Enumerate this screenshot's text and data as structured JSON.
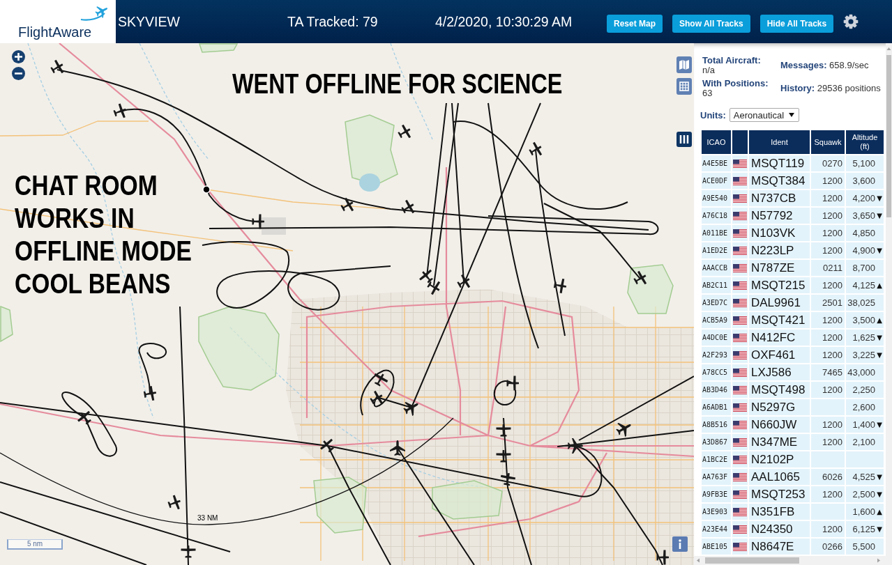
{
  "header": {
    "logo_text": "FlightAware",
    "title": "SKYVIEW",
    "tracked": "TA Tracked: 79",
    "datetime": "4/2/2020, 10:30:29 AM",
    "buttons": [
      "Reset Map",
      "Show All Tracks",
      "Hide All Tracks"
    ]
  },
  "map": {
    "annotations": [
      {
        "kind": "banner",
        "text": "WENT OFFLINE FOR SCIENCE"
      },
      {
        "kind": "note",
        "text": "CHAT ROOM WORKS IN OFFLINE MODE COOL BEANS"
      }
    ],
    "range_label": "33 NM",
    "scale_label": "5 nm"
  },
  "panel": {
    "stats": [
      {
        "label": "Total Aircraft:",
        "value": "n/a"
      },
      {
        "label": "Messages:",
        "value": "658.9/sec"
      },
      {
        "label": "With Positions:",
        "value": "63"
      },
      {
        "label": "History:",
        "value": "29536 positions"
      }
    ],
    "units": {
      "label": "Units:",
      "value": "Aeronautical"
    },
    "table": {
      "columns": [
        "ICAO",
        "Ident",
        "Squawk",
        "Altitude (ft)"
      ],
      "rows": [
        {
          "icao": "A4E5BE",
          "ident": "MSQT119",
          "squawk": "0270",
          "altitude": "5,100"
        },
        {
          "icao": "ACE0DF",
          "ident": "MSQT384",
          "squawk": "1200",
          "altitude": "3,600"
        },
        {
          "icao": "A9E540",
          "ident": "N737CB",
          "squawk": "1200",
          "altitude": "4,200",
          "trend": "▼"
        },
        {
          "icao": "A76C18",
          "ident": "N57792",
          "squawk": "1200",
          "altitude": "3,650",
          "trend": "▼"
        },
        {
          "icao": "A011BE",
          "ident": "N103VK",
          "squawk": "1200",
          "altitude": "4,850"
        },
        {
          "icao": "A1ED2E",
          "ident": "N223LP",
          "squawk": "1200",
          "altitude": "4,900",
          "trend": "▼"
        },
        {
          "icao": "AAACCB",
          "ident": "N787ZE",
          "squawk": "0211",
          "altitude": "8,700"
        },
        {
          "icao": "AB2C11",
          "ident": "MSQT215",
          "squawk": "1200",
          "altitude": "4,125",
          "trend": "▲"
        },
        {
          "icao": "A3ED7C",
          "ident": "DAL9961",
          "squawk": "2501",
          "altitude": "38,025"
        },
        {
          "icao": "ACB5A9",
          "ident": "MSQT421",
          "squawk": "1200",
          "altitude": "3,500",
          "trend": "▲"
        },
        {
          "icao": "A4DC0E",
          "ident": "N412FC",
          "squawk": "1200",
          "altitude": "1,625",
          "trend": "▼"
        },
        {
          "icao": "A2F293",
          "ident": "OXF461",
          "squawk": "1200",
          "altitude": "3,225",
          "trend": "▼"
        },
        {
          "icao": "A78CC5",
          "ident": "LXJ586",
          "squawk": "7465",
          "altitude": "43,000"
        },
        {
          "icao": "AB3D46",
          "ident": "MSQT498",
          "squawk": "1200",
          "altitude": "2,250"
        },
        {
          "icao": "A6ADB1",
          "ident": "N5297G",
          "altitude": "2,600"
        },
        {
          "icao": "A8B516",
          "ident": "N660JW",
          "squawk": "1200",
          "altitude": "1,400",
          "trend": "▼"
        },
        {
          "icao": "A3D867",
          "ident": "N347ME",
          "squawk": "1200",
          "altitude": "2,100"
        },
        {
          "icao": "A1BC2E",
          "ident": "N2102P"
        },
        {
          "icao": "AA763F",
          "ident": "AAL1065",
          "squawk": "6026",
          "altitude": "4,525",
          "trend": "▼"
        },
        {
          "icao": "A9FB3E",
          "ident": "MSQT253",
          "squawk": "1200",
          "altitude": "2,500",
          "trend": "▼"
        },
        {
          "icao": "A3E903",
          "ident": "N351FB",
          "altitude": "1,600",
          "trend": "▲"
        },
        {
          "icao": "A23E44",
          "ident": "N24350",
          "squawk": "1200",
          "altitude": "6,125",
          "trend": "▼"
        },
        {
          "icao": "ABE105",
          "ident": "N8647E",
          "squawk": "0266",
          "altitude": "5,500"
        }
      ]
    }
  }
}
